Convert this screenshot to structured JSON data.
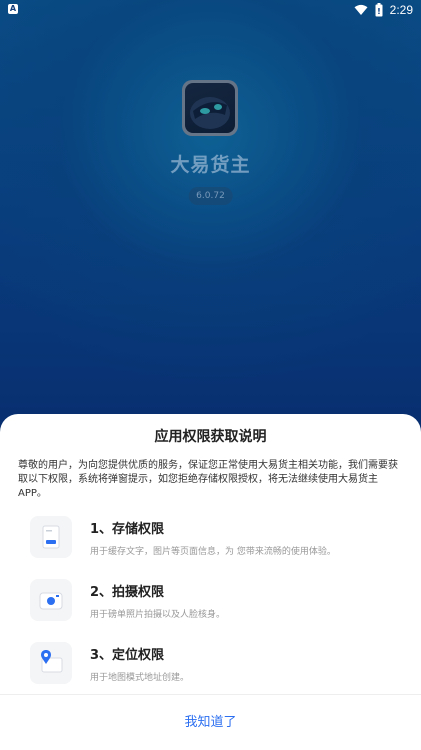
{
  "status_bar": {
    "time": "2:29",
    "notification_icon": "app-notification-icon",
    "wifi_icon": "wifi-icon",
    "battery_icon": "battery-icon"
  },
  "splash": {
    "app_name": "大易货主",
    "version": "6.0.72"
  },
  "dialog": {
    "title": "应用权限获取说明",
    "description": "尊敬的用户，为向您提供优质的服务，保证您正常使用大易货主相关功能，我们需要获取以下权限，系统将弹窗提示，如您拒绝存储权限授权，将无法继续使用大易货主APP。",
    "permissions": [
      {
        "icon": "storage-icon",
        "title": "1、存储权限",
        "description": "用于缓存文字，图片等页面信息，为 您带来流畅的使用体验。"
      },
      {
        "icon": "camera-icon",
        "title": "2、拍摄权限",
        "description": "用于磅单照片拍摄以及人脸核身。"
      },
      {
        "icon": "location-icon",
        "title": "3、定位权限",
        "description": "用于地图模式地址创建。"
      }
    ],
    "confirm_label": "我知道了",
    "accent_color": "#2c6ff0"
  }
}
